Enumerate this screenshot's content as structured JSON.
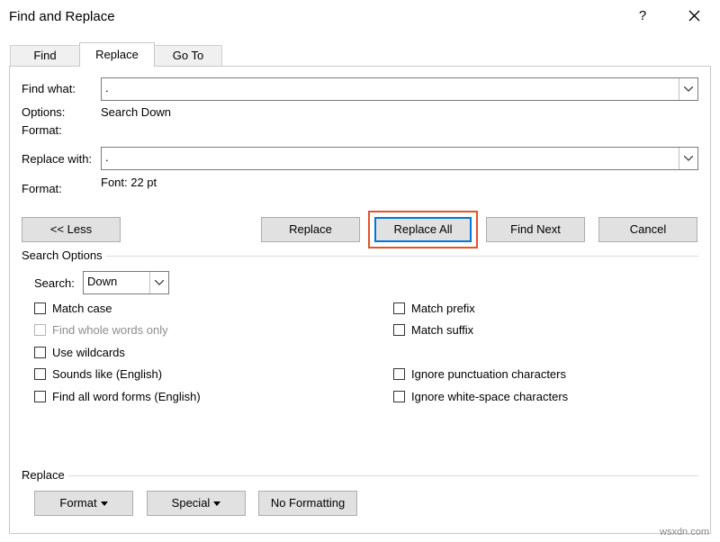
{
  "window": {
    "title": "Find and Replace",
    "help": "?",
    "close_icon": "close-icon"
  },
  "tabs": [
    {
      "label": "Find",
      "active": false
    },
    {
      "label": "Replace",
      "active": true
    },
    {
      "label": "Go To",
      "active": false
    }
  ],
  "find": {
    "label": "Find what:",
    "value": ".",
    "options_label": "Options:",
    "options_value": "Search Down",
    "format_label": "Format:"
  },
  "replace": {
    "label": "Replace with:",
    "value": ".",
    "format_label": "Format:",
    "format_value": "Font: 22 pt"
  },
  "buttons": {
    "less": "<< Less",
    "replace": "Replace",
    "replace_all": "Replace All",
    "find_next": "Find Next",
    "cancel": "Cancel"
  },
  "search_options": {
    "heading": "Search Options",
    "search_label": "Search:",
    "search_value": "Down",
    "left_checkboxes": [
      {
        "label": "Match case",
        "checked": false,
        "enabled": true
      },
      {
        "label": "Find whole words only",
        "checked": false,
        "enabled": false
      },
      {
        "label": "Use wildcards",
        "checked": false,
        "enabled": true
      },
      {
        "label": "Sounds like (English)",
        "checked": false,
        "enabled": true
      },
      {
        "label": "Find all word forms (English)",
        "checked": false,
        "enabled": true
      }
    ],
    "right_checkboxes": [
      {
        "label": "Match prefix",
        "checked": false,
        "enabled": true
      },
      {
        "label": "Match suffix",
        "checked": false,
        "enabled": true
      },
      {
        "label": "Ignore punctuation characters",
        "checked": false,
        "enabled": true
      },
      {
        "label": "Ignore white-space characters",
        "checked": false,
        "enabled": true
      }
    ]
  },
  "replace_section": {
    "heading": "Replace",
    "format_button": "Format",
    "special_button": "Special",
    "no_formatting_button": "No Formatting"
  },
  "watermark": "wsxdn.com",
  "colors": {
    "highlight": "#e0552b",
    "default_button_border": "#0078d7",
    "button_face": "#e1e1e1"
  }
}
